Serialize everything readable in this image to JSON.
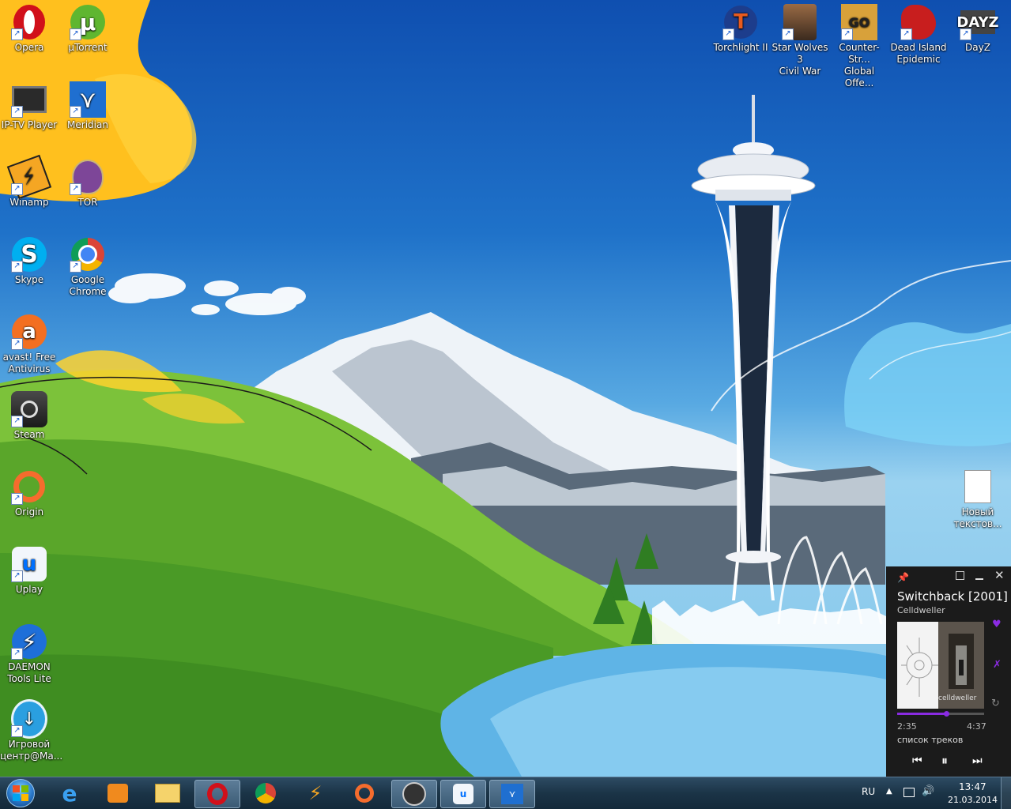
{
  "desktop_left_icons": [
    {
      "name": "icon-opera",
      "label": "Opera"
    },
    {
      "name": "icon-utorrent",
      "label": "µTorrent"
    },
    {
      "name": "icon-iptv",
      "label": "IP-TV Player"
    },
    {
      "name": "icon-meridian",
      "label": "Meridian"
    },
    {
      "name": "icon-winamp",
      "label": "Winamp"
    },
    {
      "name": "icon-tor",
      "label": "TOR"
    },
    {
      "name": "icon-skype",
      "label": "Skype"
    },
    {
      "name": "icon-chrome",
      "label": "Google\nChrome"
    },
    {
      "name": "icon-avast",
      "label": "avast! Free\nAntivirus"
    },
    {
      "name": "icon-steam",
      "label": "Steam"
    },
    {
      "name": "icon-origin",
      "label": "Origin"
    },
    {
      "name": "icon-uplay",
      "label": "Uplay"
    },
    {
      "name": "icon-daemon",
      "label": "DAEMON\nTools Lite"
    },
    {
      "name": "icon-game-center",
      "label": "Игровой\nцентр@Ma..."
    }
  ],
  "desktop_right_icons": [
    {
      "name": "icon-torchlight",
      "label": "Torchlight II"
    },
    {
      "name": "icon-star-wolves",
      "label": "Star Wolves 3\nCivil War"
    },
    {
      "name": "icon-csgo",
      "label": "Counter-Str...\nGlobal Offe..."
    },
    {
      "name": "icon-dead-island",
      "label": "Dead Island\nEpidemic"
    },
    {
      "name": "icon-dayz",
      "label": "DayZ"
    },
    {
      "name": "icon-new-text",
      "label": "Новый\nтекстов..."
    }
  ],
  "player": {
    "title": "Switchback [2001]",
    "artist": "Celldweller",
    "elapsed": "2:35",
    "duration": "4:37",
    "progress": 0.56,
    "playlist_link": "список треков",
    "album_text": "celldweller",
    "accent": "#8a2be2"
  },
  "taskbar": {
    "language": "RU",
    "time": "13:47",
    "date": "21.03.2014",
    "pinned": [
      "internet-explorer-icon",
      "media-player-icon",
      "explorer-folder-icon",
      "opera-icon",
      "chrome-icon",
      "winamp-icon",
      "origin-icon",
      "steam-icon",
      "uplay-icon",
      "meridian-icon"
    ]
  }
}
